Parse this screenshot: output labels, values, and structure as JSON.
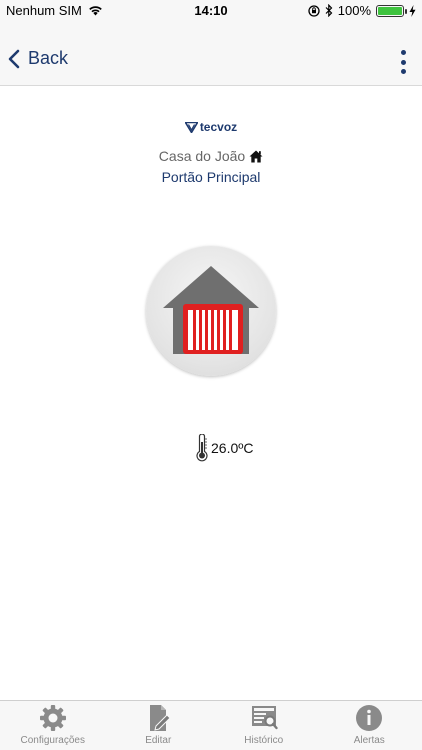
{
  "status_bar": {
    "carrier": "Nenhum SIM",
    "time": "14:10",
    "battery": "100%"
  },
  "nav": {
    "back_label": "Back"
  },
  "logo": {
    "text": "tecvoz"
  },
  "house": {
    "name": "Casa do João"
  },
  "device": {
    "name": "Portão Principal"
  },
  "temperature": {
    "value": "26.0ºC"
  },
  "tabs": [
    {
      "label": "Configurações",
      "icon": "gear-icon"
    },
    {
      "label": "Editar",
      "icon": "edit-icon"
    },
    {
      "label": "Histórico",
      "icon": "history-icon"
    },
    {
      "label": "Alertas",
      "icon": "info-icon"
    }
  ],
  "colors": {
    "primary": "#1e3a6e",
    "gate_accent": "#e02020",
    "tab_inactive": "#8a8a8a"
  }
}
